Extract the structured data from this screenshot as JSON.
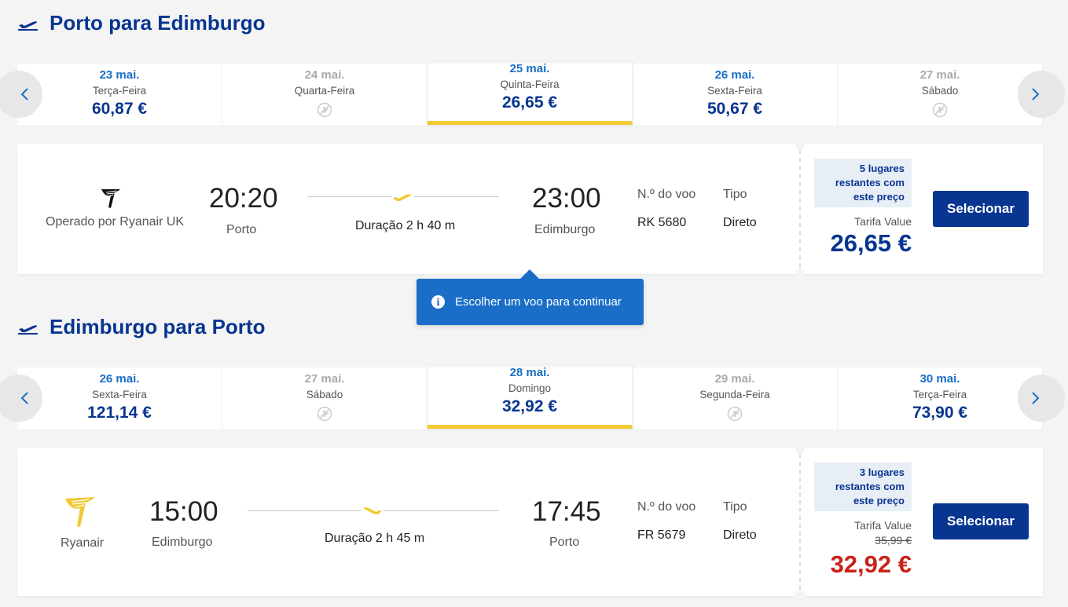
{
  "outbound": {
    "title": "Porto para Edimburgo",
    "dates": [
      {
        "date": "23 mai.",
        "weekday": "Terça-Feira",
        "price": "60,87 €",
        "available": true,
        "selected": false
      },
      {
        "date": "24 mai.",
        "weekday": "Quarta-Feira",
        "price": "",
        "available": false,
        "selected": false
      },
      {
        "date": "25 mai.",
        "weekday": "Quinta-Feira",
        "price": "26,65 €",
        "available": true,
        "selected": true
      },
      {
        "date": "26 mai.",
        "weekday": "Sexta-Feira",
        "price": "50,67 €",
        "available": true,
        "selected": false
      },
      {
        "date": "27 mai.",
        "weekday": "Sábado",
        "price": "",
        "available": false,
        "selected": false
      }
    ],
    "flight": {
      "operator": "Operado por Ryanair UK",
      "depart_time": "20:20",
      "depart_city": "Porto",
      "duration": "Duração 2 h 40 m",
      "arrive_time": "23:00",
      "arrive_city": "Edimburgo",
      "flight_no_label": "N.º do voo",
      "flight_no": "RK 5680",
      "type_label": "Tipo",
      "type": "Direto",
      "seats_note": "5 lugares restantes com este preço",
      "fare_name": "Tarifa Value",
      "price": "26,65 €",
      "select_label": "Selecionar"
    }
  },
  "tooltip": {
    "message": "Escolher um voo para continuar"
  },
  "inbound": {
    "title": "Edimburgo para Porto",
    "dates": [
      {
        "date": "26 mai.",
        "weekday": "Sexta-Feira",
        "price": "121,14 €",
        "available": true,
        "selected": false
      },
      {
        "date": "27 mai.",
        "weekday": "Sábado",
        "price": "",
        "available": false,
        "selected": false
      },
      {
        "date": "28 mai.",
        "weekday": "Domingo",
        "price": "32,92 €",
        "available": true,
        "selected": true
      },
      {
        "date": "29 mai.",
        "weekday": "Segunda-Feira",
        "price": "",
        "available": false,
        "selected": false
      },
      {
        "date": "30 mai.",
        "weekday": "Terça-Feira",
        "price": "73,90 €",
        "available": true,
        "selected": false
      }
    ],
    "flight": {
      "operator": "Ryanair",
      "depart_time": "15:00",
      "depart_city": "Edimburgo",
      "duration": "Duração 2 h 45 m",
      "arrive_time": "17:45",
      "arrive_city": "Porto",
      "flight_no_label": "N.º do voo",
      "flight_no": "FR 5679",
      "type_label": "Tipo",
      "type": "Direto",
      "seats_note": "3 lugares restantes com este preço",
      "fare_name": "Tarifa Value",
      "old_price": "35,99 €",
      "price": "32,92 €",
      "select_label": "Selecionar"
    }
  },
  "colors": {
    "brand_blue": "#073590",
    "accent_yellow": "#f1c933",
    "link_blue": "#1a6ec7",
    "sale_red": "#c9231a"
  },
  "icons": [
    "departure-plane-icon",
    "arrival-plane-icon",
    "no-flight-icon",
    "chevron-left-icon",
    "chevron-right-icon",
    "ryanair-uk-logo-icon",
    "ryanair-logo-icon",
    "info-icon"
  ]
}
